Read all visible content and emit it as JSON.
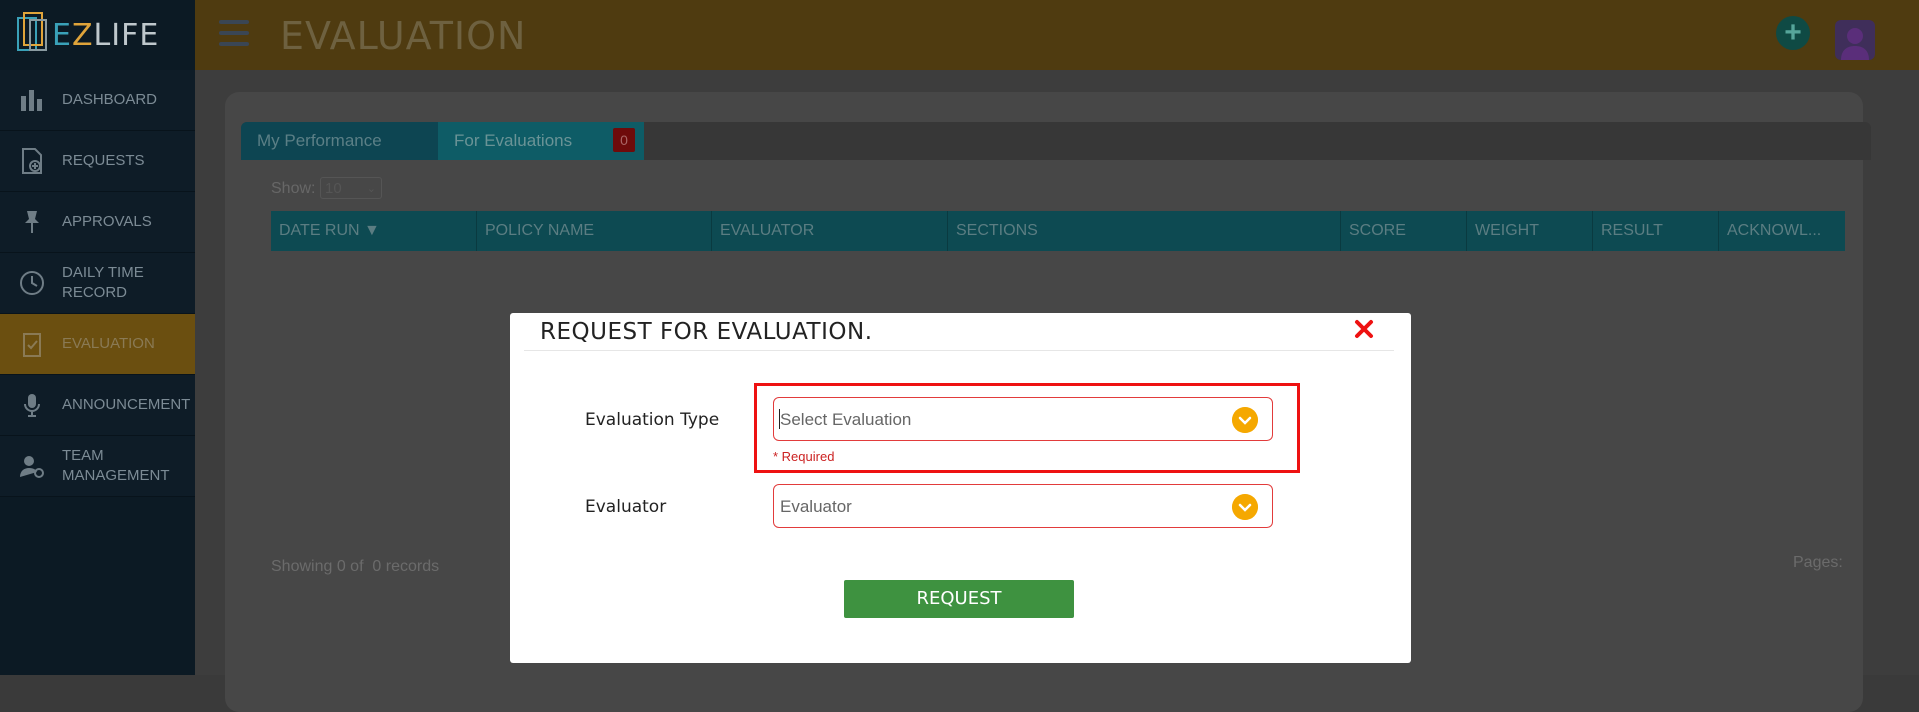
{
  "app": {
    "logo_text_parts": [
      "E",
      "Z",
      "LIFE"
    ],
    "page_title": "EVALUATION"
  },
  "sidebar": {
    "items": [
      {
        "label": "DASHBOARD",
        "icon": "bar-chart-icon"
      },
      {
        "label": "REQUESTS",
        "icon": "document-add-icon"
      },
      {
        "label": "APPROVALS",
        "icon": "pin-icon"
      },
      {
        "label": "DAILY TIME RECORD",
        "icon": "clock-icon"
      },
      {
        "label": "EVALUATION",
        "icon": "clipboard-check-icon",
        "active": true
      },
      {
        "label": "ANNOUNCEMENT",
        "icon": "microphone-icon"
      },
      {
        "label": "TEAM MANAGEMENT",
        "icon": "user-gear-icon"
      }
    ]
  },
  "tabs": [
    {
      "label": "My Performance"
    },
    {
      "label": "For Evaluations",
      "badge": "0"
    }
  ],
  "table": {
    "show_label": "Show:",
    "page_size": "10",
    "columns": [
      "DATE RUN ▼",
      "POLICY NAME",
      "EVALUATOR",
      "SECTIONS",
      "SCORE",
      "WEIGHT",
      "RESULT",
      "ACKNOWL..."
    ],
    "rows": [],
    "records_text": "Showing 0 of  0 records",
    "pages_label": "Pages:"
  },
  "modal": {
    "title": "REQUEST FOR EVALUATION.",
    "evaluation_type_label": "Evaluation Type",
    "evaluation_type_placeholder": "Select Evaluation",
    "required_text": "* Required",
    "evaluator_label": "Evaluator",
    "evaluator_placeholder": "Evaluator",
    "request_button": "REQUEST"
  },
  "colors": {
    "accent_yellow": "#f5a800",
    "error_red": "#e11111",
    "button_green": "#3e9240",
    "teal": "#0d4a52"
  }
}
